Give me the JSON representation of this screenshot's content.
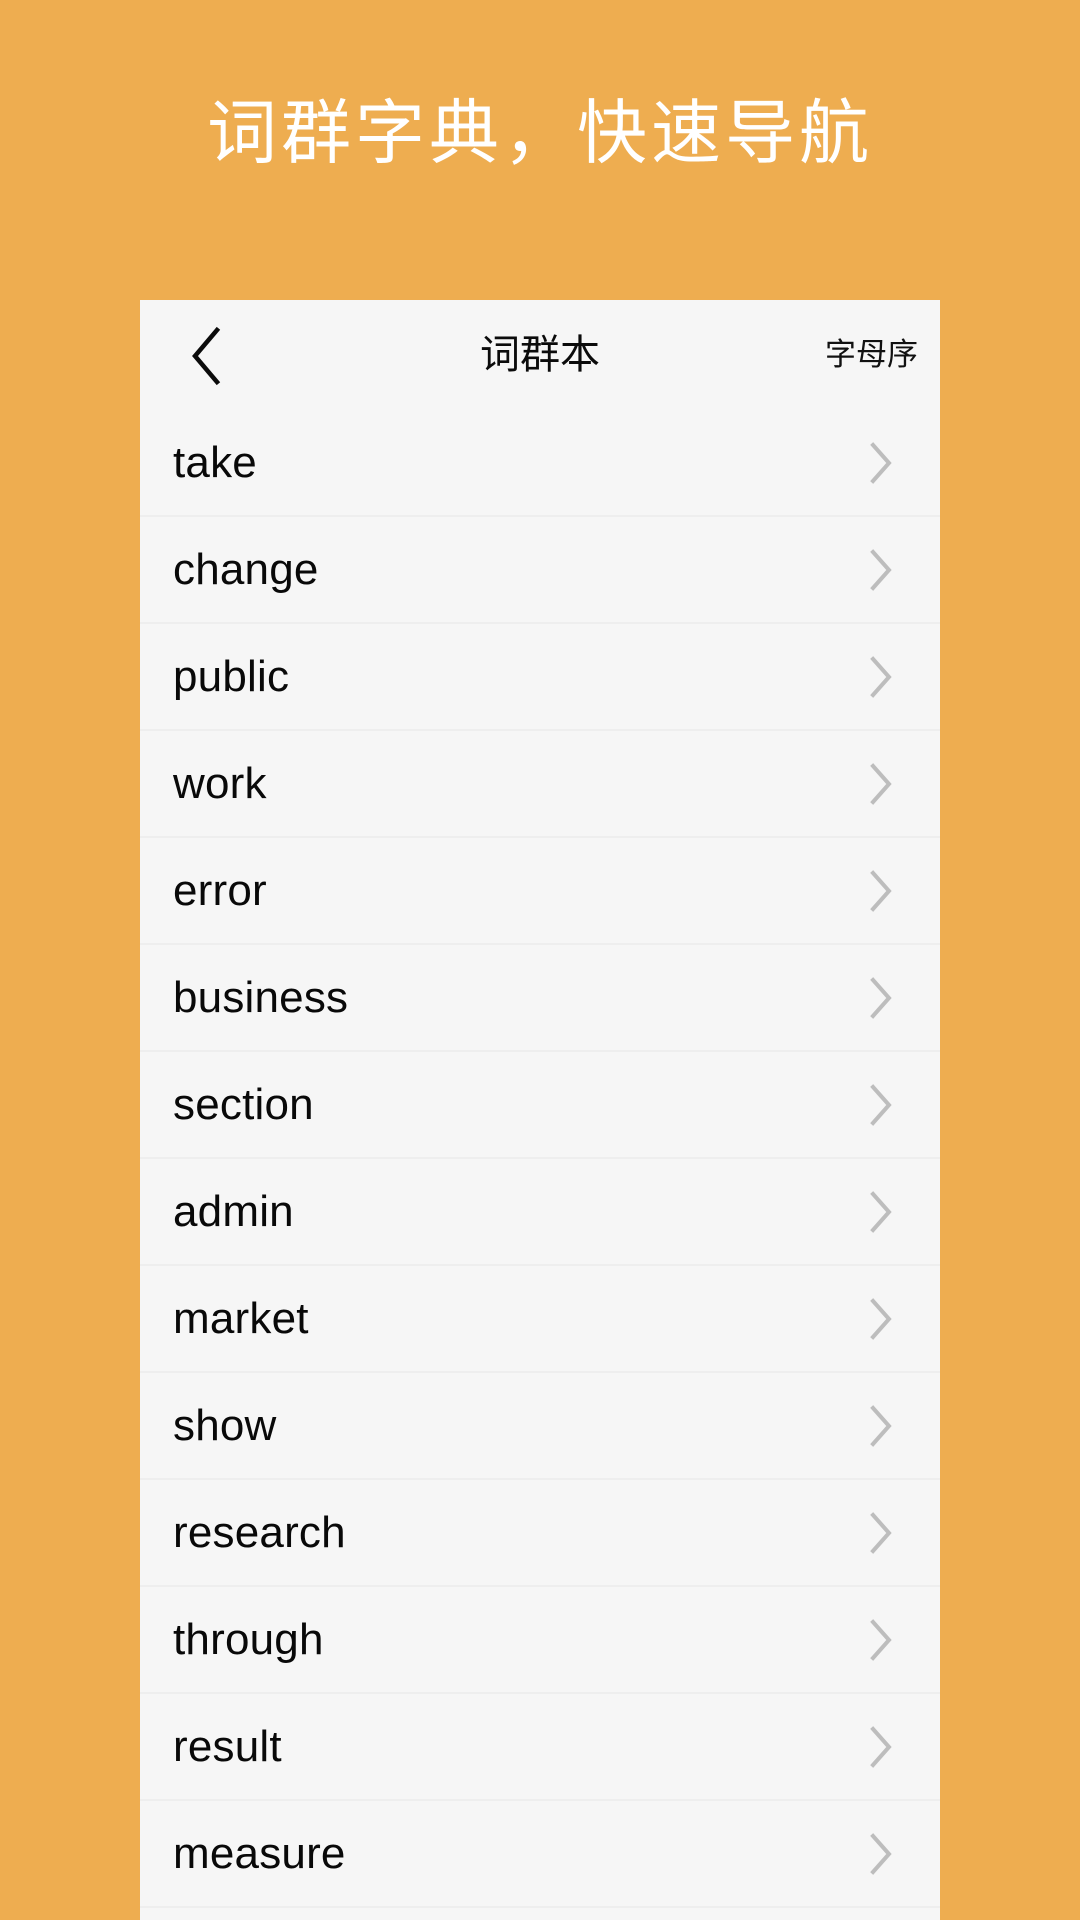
{
  "theme": {
    "background_color": "#eead50",
    "card_color": "#f6f6f6",
    "headline_color": "#ffffff",
    "text_color": "#090909",
    "divider_color": "#eeeeee",
    "chevron_color": "#bdbdbd"
  },
  "promo": {
    "headline": "词群字典，快速导航"
  },
  "navbar": {
    "back_icon": "chevron-left-icon",
    "title": "词群本",
    "action_label": "字母序"
  },
  "list": {
    "chevron_icon": "chevron-right-icon",
    "items": [
      {
        "word": "take"
      },
      {
        "word": "change"
      },
      {
        "word": "public"
      },
      {
        "word": "work"
      },
      {
        "word": "error"
      },
      {
        "word": "business"
      },
      {
        "word": "section"
      },
      {
        "word": "admin"
      },
      {
        "word": "market"
      },
      {
        "word": "show"
      },
      {
        "word": "research"
      },
      {
        "word": "through"
      },
      {
        "word": "result"
      },
      {
        "word": "measure"
      }
    ]
  }
}
